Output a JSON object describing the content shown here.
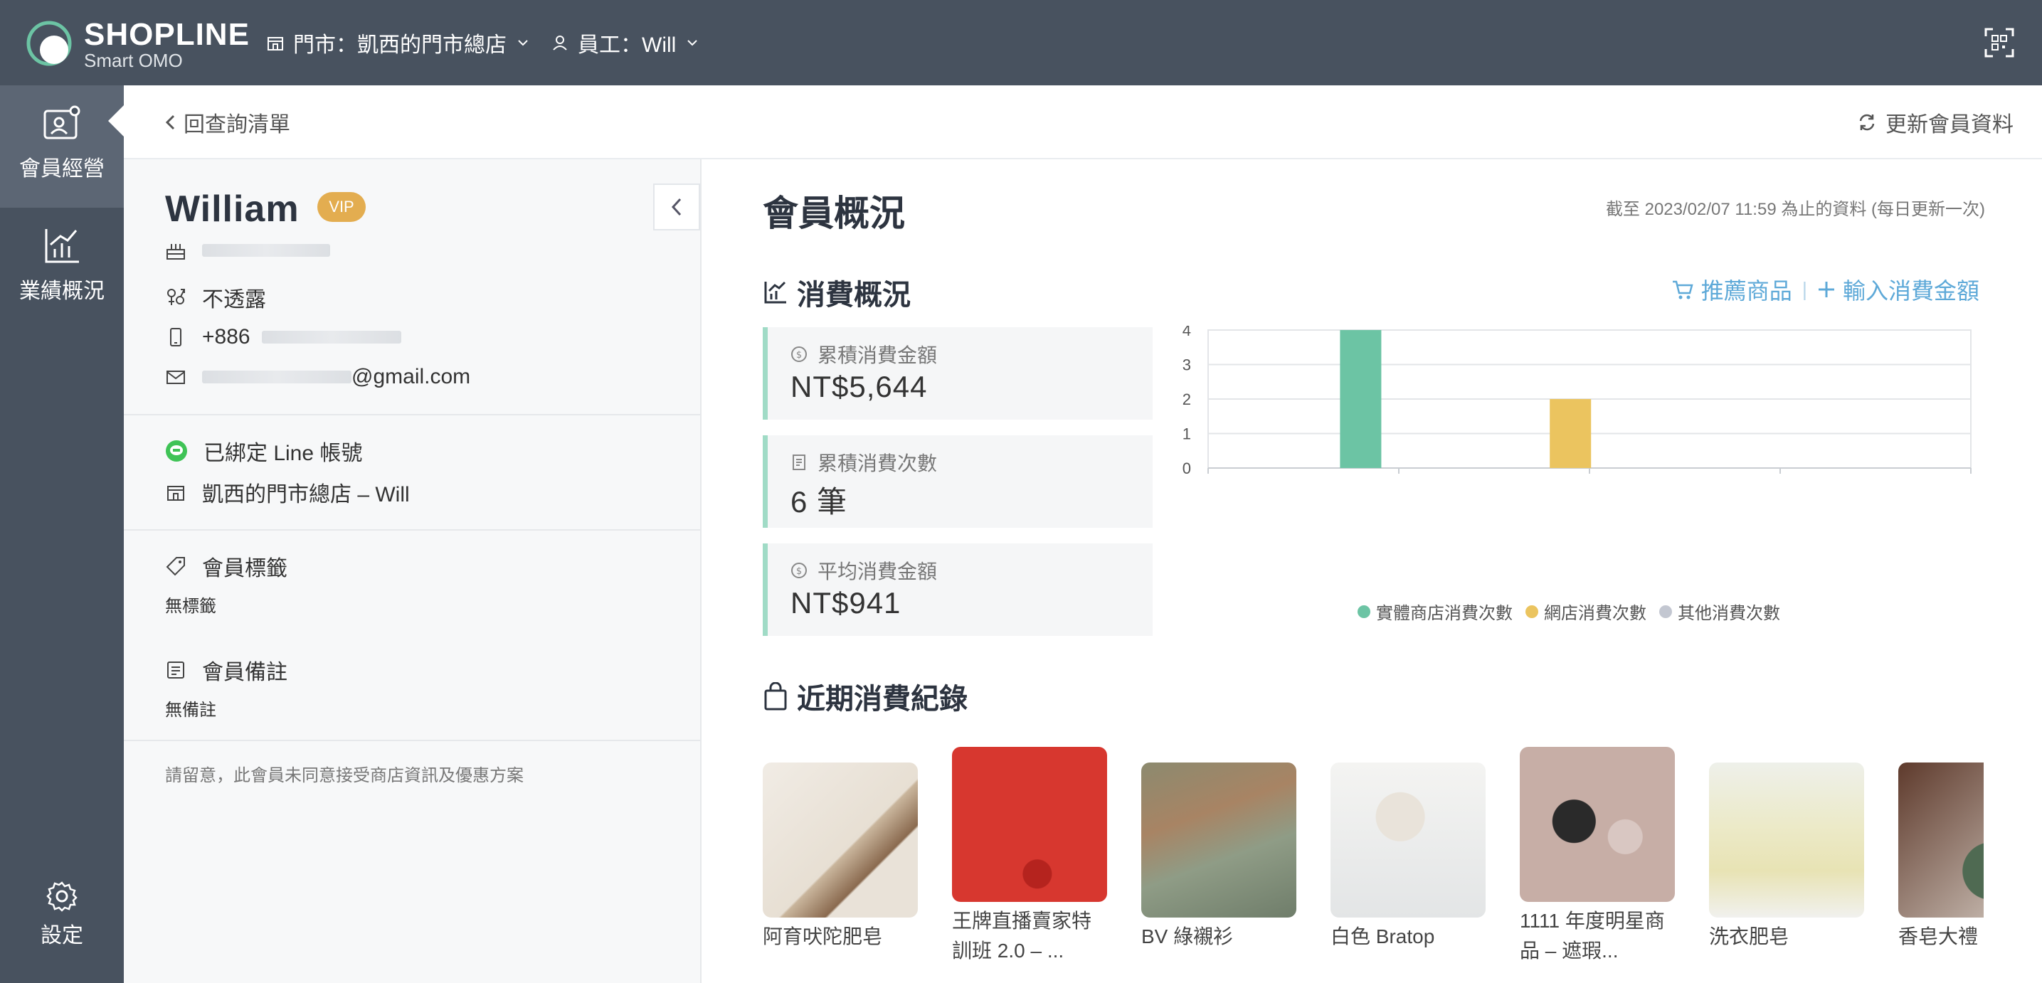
{
  "header": {
    "logo_text": "SHOPLINE",
    "logo_sub": "Smart OMO",
    "store_label": "門市：凱西的門市總店",
    "staff_label": "員工：Will"
  },
  "sidebar": {
    "items": [
      {
        "label": "會員經營",
        "icon": "member-card-icon",
        "active": true
      },
      {
        "label": "業績概況",
        "icon": "chart-icon",
        "active": false
      }
    ],
    "settings_label": "設定"
  },
  "topbar": {
    "back_label": "回查詢清單",
    "refresh_label": "更新會員資料"
  },
  "profile": {
    "name": "William",
    "badge": "VIP",
    "gender": "不透露",
    "phone_prefix": "+886",
    "email_suffix": "@gmail.com",
    "line_status": "已綁定 Line 帳號",
    "store_staff": "凱西的門市總店 – Will",
    "tags_title": "會員標籤",
    "tags_value": "無標籤",
    "notes_title": "會員備註",
    "notes_value": "無備註",
    "consent_note": "請留意，此會員未同意接受商店資訊及優惠方案"
  },
  "main": {
    "title": "會員概況",
    "updated": "截至 2023/02/07 11:59 為止的資料 (每日更新一次)",
    "spending_title": "消費概況",
    "recommend_label": "推薦商品",
    "input_label": "輸入消費金額",
    "recent_title": "近期消費紀錄"
  },
  "stats": [
    {
      "label": "累積消費金額",
      "value": "NT$5,644"
    },
    {
      "label": "累積消費次數",
      "value": "6 筆"
    },
    {
      "label": "平均消費金額",
      "value": "NT$941"
    }
  ],
  "colors": {
    "accent_blue": "#5ea9d8",
    "green": "#6cc4a4",
    "yellow": "#ebc45f",
    "gray": "#c3c7d1",
    "nav_bg": "#48525f"
  },
  "chart_data": {
    "type": "bar",
    "categories": [
      "實體商店消費次數",
      "網店消費次數",
      "其他消費次數"
    ],
    "values": [
      4,
      2,
      0
    ],
    "colors": [
      "#6cc4a4",
      "#ebc45f",
      "#c3c7d1"
    ],
    "yticks": [
      "0",
      "1",
      "2",
      "3",
      "4"
    ],
    "ylim": [
      0,
      4
    ],
    "legend": "bottom",
    "grid": true
  },
  "products": [
    {
      "name": "阿育吠陀肥皂"
    },
    {
      "name": "王牌直播賣家特訓班 2.0 – ..."
    },
    {
      "name": "BV 綠襯衫"
    },
    {
      "name": "白色 Bratop"
    },
    {
      "name": "1111 年度明星商品 – 遮瑕..."
    },
    {
      "name": "洗衣肥皂"
    },
    {
      "name": "香皂大禮"
    }
  ]
}
